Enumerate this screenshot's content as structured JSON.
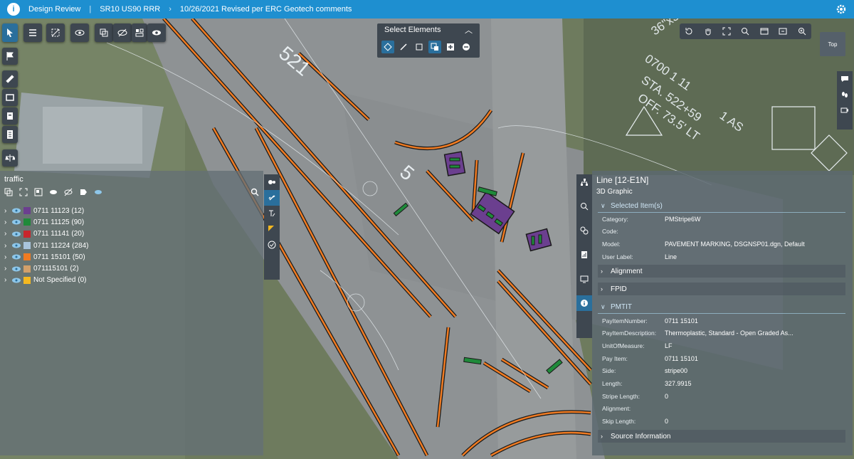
{
  "topbar": {
    "app_icon": "bentley-logo-icon",
    "breadcrumbs": [
      "Design Review",
      "SR10 US90 RRR",
      "10/26/2021 Revised per ERC Geotech comments"
    ],
    "settings_icon": "gear-icon"
  },
  "map_labels": {
    "lane_a": "521",
    "lane_b": "5",
    "callout_line1": "36\"x36\"",
    "callout_line2": "0700 1 11",
    "callout_line3": "STA. 522+59",
    "callout_line4": "OFF. 73.5' LT",
    "callout_line5": "1 AS"
  },
  "select_elements": {
    "title": "Select Elements",
    "collapse_icon": "chevron-up-icon"
  },
  "view_cube": {
    "label": "Top"
  },
  "traffic_panel": {
    "title": "traffic",
    "items": [
      {
        "label": "0711 11123 (12)",
        "color": "#6b3f8f"
      },
      {
        "label": "0711 11125 (90)",
        "color": "#1f8a3a"
      },
      {
        "label": "0711 11141 (20)",
        "color": "#c8262d"
      },
      {
        "label": "0711 11224 (284)",
        "color": "#a9c4dc"
      },
      {
        "label": "0711 15101 (50)",
        "color": "#f07b22"
      },
      {
        "label": "071115101 (2)",
        "color": "#d2a06a"
      },
      {
        "label": "Not Specified (0)",
        "color": "#f5b820"
      }
    ]
  },
  "properties_panel": {
    "title": "Line [12-E1N]",
    "subtitle": "3D Graphic",
    "sections": {
      "selected_items": "Selected Item(s)",
      "alignment": "Alignment",
      "fpid": "FPID",
      "pmtit": "PMTIT",
      "source_information": "Source Information"
    },
    "selected_items_rows": [
      {
        "key": "Category:",
        "value": "PMStripe6W"
      },
      {
        "key": "Code:",
        "value": ""
      },
      {
        "key": "Model:",
        "value": "PAVEMENT MARKING, DSGNSP01.dgn, Default"
      },
      {
        "key": "User Label:",
        "value": "Line"
      }
    ],
    "pmtit_rows": [
      {
        "key": "PayItemNumber:",
        "value": "0711 15101"
      },
      {
        "key": "PayItemDescription:",
        "value": "Thermoplastic, Standard - Open Graded As..."
      },
      {
        "key": "UnitOfMeasure:",
        "value": "LF"
      },
      {
        "key": "Pay Item:",
        "value": "0711 15101"
      },
      {
        "key": "Side:",
        "value": "stripe00"
      },
      {
        "key": "Length:",
        "value": "327.9915"
      },
      {
        "key": "Stripe Length:",
        "value": "0"
      },
      {
        "key": "Alignment:",
        "value": ""
      },
      {
        "key": "Skip Length:",
        "value": "0"
      }
    ]
  },
  "colors": {
    "header_blue": "#1e8fd0",
    "stripe_orange": "#f07b22",
    "highlight_green": "#1f8a3a",
    "highlight_purple": "#6b3f8f"
  }
}
